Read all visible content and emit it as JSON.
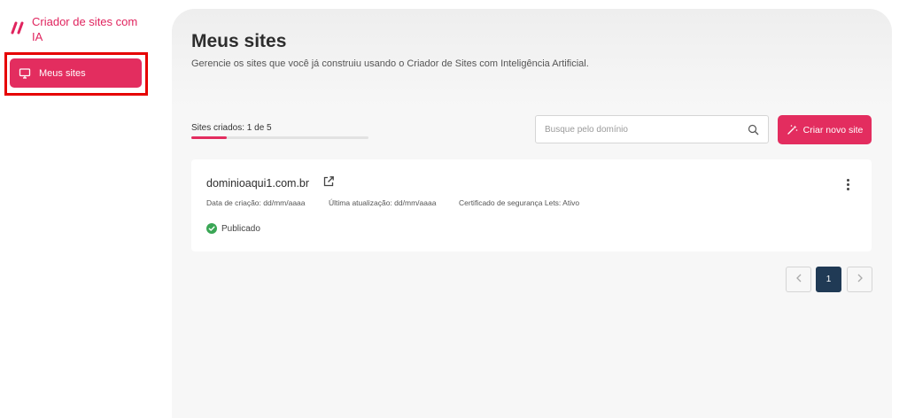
{
  "sidebar": {
    "brand_title": "Criador de sites com IA",
    "brand_icon": "double-slash-logo",
    "items": [
      {
        "label": "Meus sites",
        "icon": "monitor-icon",
        "active": true
      }
    ]
  },
  "header": {
    "title": "Meus sites",
    "subtitle": "Gerencie os sites que você já construiu usando o Criador de Sites com Inteligência Artificial."
  },
  "counter": {
    "label": "Sites criados: 1 de 5",
    "used": 1,
    "total": 5
  },
  "search": {
    "placeholder": "Busque pelo domínio",
    "value": "",
    "icon": "search-icon"
  },
  "create_button": {
    "label": "Criar novo site",
    "icon": "magic-wand-icon"
  },
  "sites": [
    {
      "domain": "dominioaqui1.com.br",
      "created": "Data de criação: dd/mm/aaaa",
      "updated": "Última atualização: dd/mm/aaaa",
      "certificate": "Certificado de segurança Lets: Ativo",
      "status": "Publicado"
    }
  ],
  "pagination": {
    "current_page": "1"
  },
  "colors": {
    "accent": "#e32d5f",
    "brand_text": "#e0245e",
    "highlight_border": "#e60000",
    "pager_active": "#203a55",
    "status_ok": "#3aa655"
  }
}
